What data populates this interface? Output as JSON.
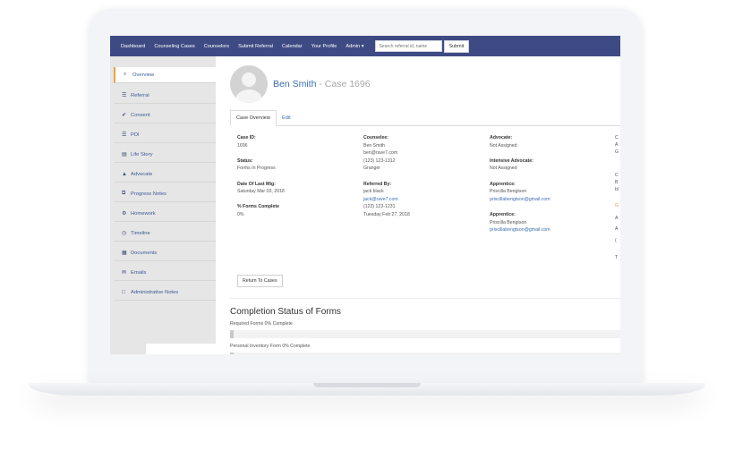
{
  "nav": {
    "items": [
      "Dashboard",
      "Counseling Cases",
      "Counselors",
      "Submit Referral",
      "Calendar",
      "Your Profile",
      "Admin ▾"
    ],
    "search_placeholder": "Search referral id, name",
    "submit_label": "Submit"
  },
  "sidebar": {
    "items": [
      {
        "icon": "search-icon",
        "glyph": "⌕",
        "label": "Overview"
      },
      {
        "icon": "list-icon",
        "glyph": "☰",
        "label": "Referral"
      },
      {
        "icon": "check-icon",
        "glyph": "✔",
        "label": "Consent"
      },
      {
        "icon": "database-icon",
        "glyph": "☰",
        "label": "PDI"
      },
      {
        "icon": "book-icon",
        "glyph": "▤",
        "label": "Life Story"
      },
      {
        "icon": "user-icon",
        "glyph": "▲",
        "label": "Advocate"
      },
      {
        "icon": "copy-icon",
        "glyph": "⧉",
        "label": "Progress Notes"
      },
      {
        "icon": "gear-icon",
        "glyph": "⚙",
        "label": "Homework"
      },
      {
        "icon": "clock-icon",
        "glyph": "◷",
        "label": "Timeline"
      },
      {
        "icon": "documents-icon",
        "glyph": "▦",
        "label": "Documents"
      },
      {
        "icon": "envelope-icon",
        "glyph": "✉",
        "label": "Emails"
      },
      {
        "icon": "note-icon",
        "glyph": "□",
        "label": "Administrative Notes"
      }
    ]
  },
  "header": {
    "name": "Ben Smith",
    "case_suffix": " - Case 1696"
  },
  "tabs": {
    "active": "Case Overview",
    "edit": "Edit"
  },
  "case": {
    "col1": {
      "case_id_label": "Case ID:",
      "case_id": "1696",
      "status_label": "Status:",
      "status": "Forms In Progress",
      "last_mtg_label": "Date Of Last Mtg:",
      "last_mtg": "Saturday Mar 03, 2018",
      "forms_label": "% Forms Complete",
      "forms": "0%"
    },
    "col2": {
      "counselee_label": "Counselee:",
      "name": "Ben Smith",
      "email": "ben@rave7.com",
      "phone": "(123) 123-1312",
      "city": "Granger",
      "referred_label": "Referred By:",
      "ref_name": "jack black",
      "ref_email": "jack@rave7.com",
      "ref_phone": "(123) 123-1231",
      "ref_date": "Tuesday Feb 27, 2018"
    },
    "col3": {
      "advocate_label": "Advocate:",
      "advocate": "Not Assigned",
      "intensive_label": "Intensive Advocate:",
      "intensive": "Not Assigned",
      "apprentice1_label": "Apprentice:",
      "apprentice1_name": "Priscilla Bengtson",
      "apprentice1_email": "priscillabengtson@gmail.com",
      "apprentice2_label": "Apprentice:",
      "apprentice2_name": "Priscilla Bengtson",
      "apprentice2_email": "priscillabengtson@gmail.com"
    },
    "edge": [
      "C",
      "A",
      "G",
      "C",
      "B",
      "bl",
      "G",
      "A",
      "A",
      "(",
      "T"
    ]
  },
  "return_label": "Return To Cases",
  "completion": {
    "title": "Completion Status of Forms",
    "required_label": "Required Forms 0% Complete",
    "required_value": 0,
    "pif_label": "Personal Inventory Form 0% Complete",
    "pif_value": 0
  },
  "colors": {
    "navbar": "#3e4a83",
    "link": "#3a6db0",
    "active_border": "#f0a23b",
    "sidebar": "#e6e6e6"
  }
}
